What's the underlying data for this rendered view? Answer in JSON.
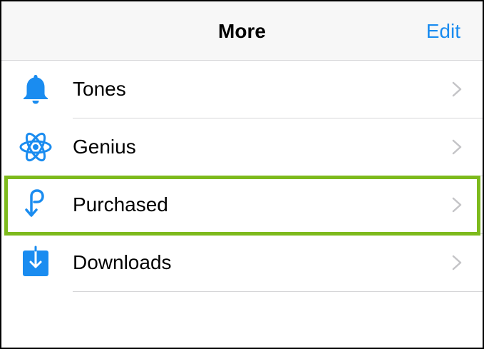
{
  "navbar": {
    "title": "More",
    "edit_label": "Edit"
  },
  "items": [
    {
      "label": "Tones",
      "icon": "bell-icon"
    },
    {
      "label": "Genius",
      "icon": "atom-icon"
    },
    {
      "label": "Purchased",
      "icon": "purchased-icon",
      "highlighted": true
    },
    {
      "label": "Downloads",
      "icon": "download-icon"
    }
  ],
  "colors": {
    "accent": "#1a8cf0",
    "highlight": "#7dba1c",
    "chevron": "#c4c4c7",
    "separator": "#d6d6d8",
    "navbar_bg": "#f7f7f7"
  }
}
